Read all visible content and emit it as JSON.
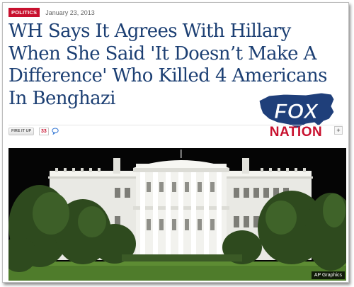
{
  "article": {
    "category": "POLITICS",
    "date": "January 23, 2013",
    "headline": "WH Says It Agrees With Hillary When She Said 'It Doesn’t Make A Difference' Who Killed 4 Americans In Benghazi"
  },
  "logo": {
    "line1": "FOX",
    "line2": "NATION"
  },
  "share": {
    "fire_label": "FIRE IT UP",
    "fire_count": "33",
    "plus_label": "+"
  },
  "photo": {
    "credit": "AP Graphics"
  },
  "colors": {
    "headline": "#1c3f73",
    "category_tag": "#c8102e",
    "logo_red": "#c8102e",
    "logo_blue": "#1f3f7a"
  }
}
